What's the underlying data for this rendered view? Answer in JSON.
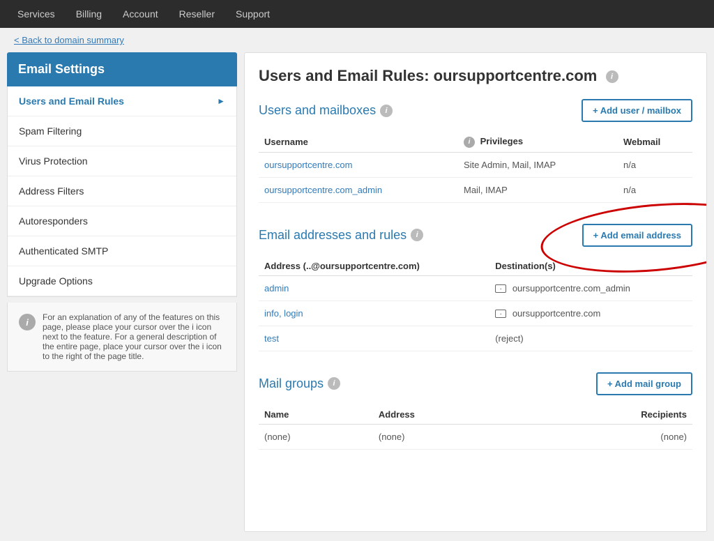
{
  "nav": {
    "items": [
      {
        "label": "Services",
        "id": "services"
      },
      {
        "label": "Billing",
        "id": "billing"
      },
      {
        "label": "Account",
        "id": "account"
      },
      {
        "label": "Reseller",
        "id": "reseller"
      },
      {
        "label": "Support",
        "id": "support"
      }
    ]
  },
  "back_link": "< Back to domain summary",
  "sidebar": {
    "title": "Email Settings",
    "items": [
      {
        "label": "Users and Email Rules",
        "active": true,
        "id": "users-email-rules"
      },
      {
        "label": "Spam Filtering",
        "active": false,
        "id": "spam-filtering"
      },
      {
        "label": "Virus Protection",
        "active": false,
        "id": "virus-protection"
      },
      {
        "label": "Address Filters",
        "active": false,
        "id": "address-filters"
      },
      {
        "label": "Autoresponders",
        "active": false,
        "id": "autoresponders"
      },
      {
        "label": "Authenticated SMTP",
        "active": false,
        "id": "authenticated-smtp"
      },
      {
        "label": "Upgrade Options",
        "active": false,
        "id": "upgrade-options"
      }
    ],
    "info_text": "For an explanation of any of the features on this page, please place your cursor over the i icon next to the feature. For a general description of the entire page, place your cursor over the i icon to the right of the page title."
  },
  "page": {
    "title": "Users and Email Rules:",
    "domain": "oursupportcentre.com",
    "sections": {
      "users_mailboxes": {
        "title": "Users and mailboxes",
        "add_button": "+ Add user / mailbox",
        "table": {
          "headers": [
            "Username",
            "Privileges",
            "Webmail"
          ],
          "rows": [
            {
              "username": "oursupportcentre.com",
              "privileges": "Site Admin, Mail, IMAP",
              "webmail": "n/a"
            },
            {
              "username": "oursupportcentre.com_admin",
              "privileges": "Mail, IMAP",
              "webmail": "n/a"
            }
          ]
        }
      },
      "email_addresses": {
        "title": "Email addresses and rules",
        "add_button": "+ Add email address",
        "table": {
          "headers": [
            "Address (..@oursupportcentre.com)",
            "Destination(s)"
          ],
          "rows": [
            {
              "address": "admin",
              "destination": "oursupportcentre.com_admin",
              "has_mail_icon": true
            },
            {
              "address": "info, login",
              "destination": "oursupportcentre.com",
              "has_mail_icon": true
            },
            {
              "address": "test",
              "destination": "(reject)",
              "has_mail_icon": false
            }
          ]
        }
      },
      "mail_groups": {
        "title": "Mail groups",
        "add_button": "+ Add mail group",
        "table": {
          "headers": [
            "Name",
            "Address",
            "Recipients"
          ],
          "rows": [
            {
              "name": "(none)",
              "address": "(none)",
              "recipients": "(none)"
            }
          ]
        }
      }
    }
  }
}
